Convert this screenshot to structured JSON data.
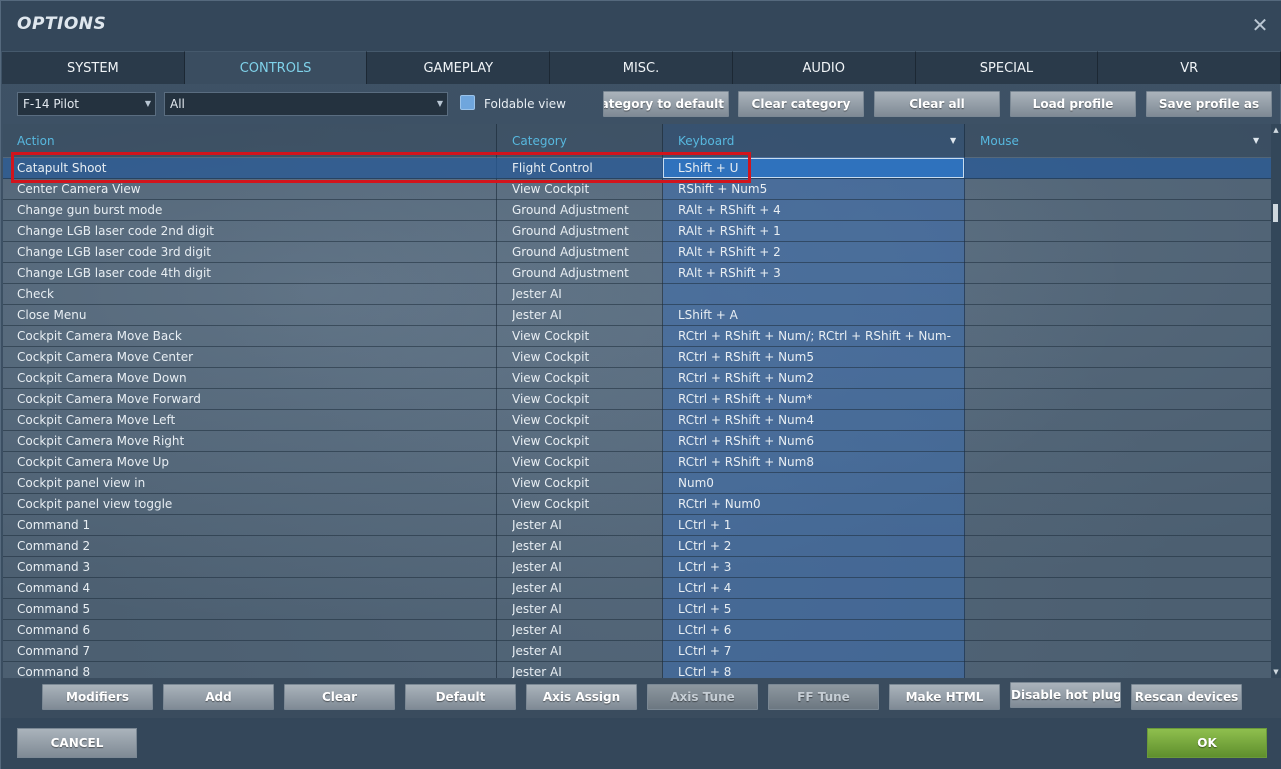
{
  "window": {
    "title": "OPTIONS",
    "close_glyph": "✕"
  },
  "tabs": [
    {
      "label": "SYSTEM",
      "active": false
    },
    {
      "label": "CONTROLS",
      "active": true
    },
    {
      "label": "GAMEPLAY",
      "active": false
    },
    {
      "label": "MISC.",
      "active": false
    },
    {
      "label": "AUDIO",
      "active": false
    },
    {
      "label": "SPECIAL",
      "active": false
    },
    {
      "label": "VR",
      "active": false
    }
  ],
  "filters": {
    "aircraft_select": "F-14 Pilot",
    "category_select": "All",
    "foldable_view_label": "Foldable view",
    "reset_category_label": "Reset category to default",
    "clear_category_label": "Clear category",
    "clear_all_label": "Clear all",
    "load_profile_label": "Load profile",
    "save_profile_label": "Save profile as"
  },
  "table": {
    "headers": {
      "action": "Action",
      "category": "Category",
      "keyboard": "Keyboard",
      "mouse": "Mouse"
    },
    "rows": [
      {
        "action": "Catapult Shoot",
        "category": "Flight Control",
        "keyboard": "LShift + U",
        "selected": true
      },
      {
        "action": "Center Camera View",
        "category": "View Cockpit",
        "keyboard": "RShift + Num5"
      },
      {
        "action": "Change gun burst mode",
        "category": "Ground Adjustment",
        "keyboard": "RAlt + RShift + 4"
      },
      {
        "action": "Change LGB laser code 2nd digit",
        "category": "Ground Adjustment",
        "keyboard": "RAlt + RShift + 1"
      },
      {
        "action": "Change LGB laser code 3rd digit",
        "category": "Ground Adjustment",
        "keyboard": "RAlt + RShift + 2"
      },
      {
        "action": "Change LGB laser code 4th digit",
        "category": "Ground Adjustment",
        "keyboard": "RAlt + RShift + 3"
      },
      {
        "action": "Check",
        "category": "Jester AI",
        "keyboard": ""
      },
      {
        "action": "Close Menu",
        "category": "Jester AI",
        "keyboard": "LShift + A"
      },
      {
        "action": "Cockpit Camera Move Back",
        "category": "View Cockpit",
        "keyboard": "RCtrl + RShift + Num/; RCtrl + RShift + Num-"
      },
      {
        "action": "Cockpit Camera Move Center",
        "category": "View Cockpit",
        "keyboard": "RCtrl + RShift + Num5"
      },
      {
        "action": "Cockpit Camera Move Down",
        "category": "View Cockpit",
        "keyboard": "RCtrl + RShift + Num2"
      },
      {
        "action": "Cockpit Camera Move Forward",
        "category": "View Cockpit",
        "keyboard": "RCtrl + RShift + Num*"
      },
      {
        "action": "Cockpit Camera Move Left",
        "category": "View Cockpit",
        "keyboard": "RCtrl + RShift + Num4"
      },
      {
        "action": "Cockpit Camera Move Right",
        "category": "View Cockpit",
        "keyboard": "RCtrl + RShift + Num6"
      },
      {
        "action": "Cockpit Camera Move Up",
        "category": "View Cockpit",
        "keyboard": "RCtrl + RShift + Num8"
      },
      {
        "action": "Cockpit panel view in",
        "category": "View Cockpit",
        "keyboard": "Num0"
      },
      {
        "action": "Cockpit panel view toggle",
        "category": "View Cockpit",
        "keyboard": "RCtrl + Num0"
      },
      {
        "action": "Command 1",
        "category": "Jester AI",
        "keyboard": "LCtrl + 1"
      },
      {
        "action": "Command 2",
        "category": "Jester AI",
        "keyboard": "LCtrl + 2"
      },
      {
        "action": "Command 3",
        "category": "Jester AI",
        "keyboard": "LCtrl + 3"
      },
      {
        "action": "Command 4",
        "category": "Jester AI",
        "keyboard": "LCtrl + 4"
      },
      {
        "action": "Command 5",
        "category": "Jester AI",
        "keyboard": "LCtrl + 5"
      },
      {
        "action": "Command 6",
        "category": "Jester AI",
        "keyboard": "LCtrl + 6"
      },
      {
        "action": "Command 7",
        "category": "Jester AI",
        "keyboard": "LCtrl + 7"
      },
      {
        "action": "Command 8",
        "category": "Jester AI",
        "keyboard": "LCtrl + 8"
      }
    ]
  },
  "toolbar": {
    "modifiers": "Modifiers",
    "add": "Add",
    "clear": "Clear",
    "default": "Default",
    "axis_assign": "Axis Assign",
    "axis_tune": "Axis Tune",
    "ff_tune": "FF Tune",
    "make_html": "Make HTML",
    "disable_hot_plug": "Disable hot plug",
    "rescan_devices": "Rescan devices"
  },
  "footer": {
    "cancel": "CANCEL",
    "ok": "OK"
  },
  "colors": {
    "accent": "#57b8df",
    "highlight": "#d2141c",
    "ok_green": "#7aac3f"
  }
}
